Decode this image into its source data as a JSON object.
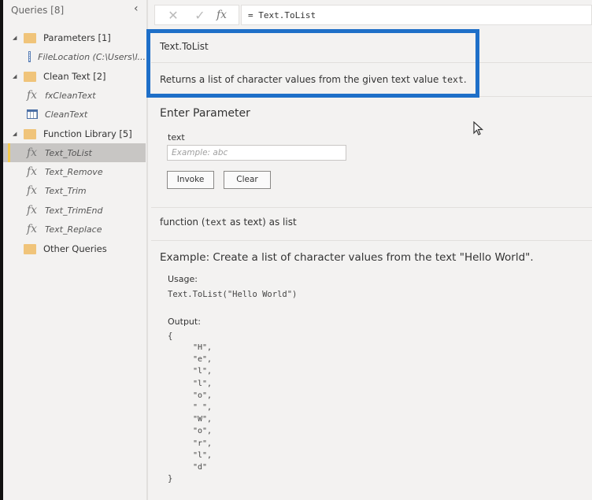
{
  "sidebar": {
    "header": "Queries [8]",
    "collapse_icon": "chevron-left-icon",
    "groups": [
      {
        "label": "Parameters [1]",
        "items": [
          {
            "label": "FileLocation (C:\\Users\\l...",
            "icon": "parameter-icon"
          }
        ]
      },
      {
        "label": "Clean Text [2]",
        "items": [
          {
            "label": "fxCleanText",
            "icon": "function-icon"
          },
          {
            "label": "CleanText",
            "icon": "table-icon"
          }
        ]
      },
      {
        "label": "Function Library [5]",
        "items": [
          {
            "label": "Text_ToList",
            "icon": "function-icon",
            "selected": true
          },
          {
            "label": "Text_Remove",
            "icon": "function-icon"
          },
          {
            "label": "Text_Trim",
            "icon": "function-icon"
          },
          {
            "label": "Text_TrimEnd",
            "icon": "function-icon"
          },
          {
            "label": "Text_Replace",
            "icon": "function-icon"
          }
        ]
      },
      {
        "label": "Other Queries",
        "items": []
      }
    ]
  },
  "formula_bar": {
    "cancel": "✕",
    "commit": "✓",
    "fx": "fx",
    "formula": "= Text.ToList"
  },
  "function_info": {
    "name": "Text.ToList",
    "description_prefix": "Returns a list of character values from the given text value ",
    "description_code": "text",
    "description_suffix": ".",
    "highlight_color": "#1e6fc8"
  },
  "parameters": {
    "title": "Enter Parameter",
    "param_label": "text",
    "param_placeholder": "Example: abc",
    "param_value": "",
    "invoke_label": "Invoke",
    "clear_label": "Clear"
  },
  "signature": {
    "prefix": "function (",
    "code": "text",
    "suffix": " as text) as list"
  },
  "example": {
    "title": "Example: Create a list of character values from the text \"Hello World\".",
    "usage_label": "Usage:",
    "usage_code": "Text.ToList(\"Hello World\")",
    "output_label": "Output:",
    "open_brace": "{",
    "output_items": [
      "\"H\",",
      "\"e\",",
      "\"l\",",
      "\"l\",",
      "\"o\",",
      "\" \",",
      "\"W\",",
      "\"o\",",
      "\"r\",",
      "\"l\",",
      "\"d\""
    ],
    "close_brace": "}"
  }
}
